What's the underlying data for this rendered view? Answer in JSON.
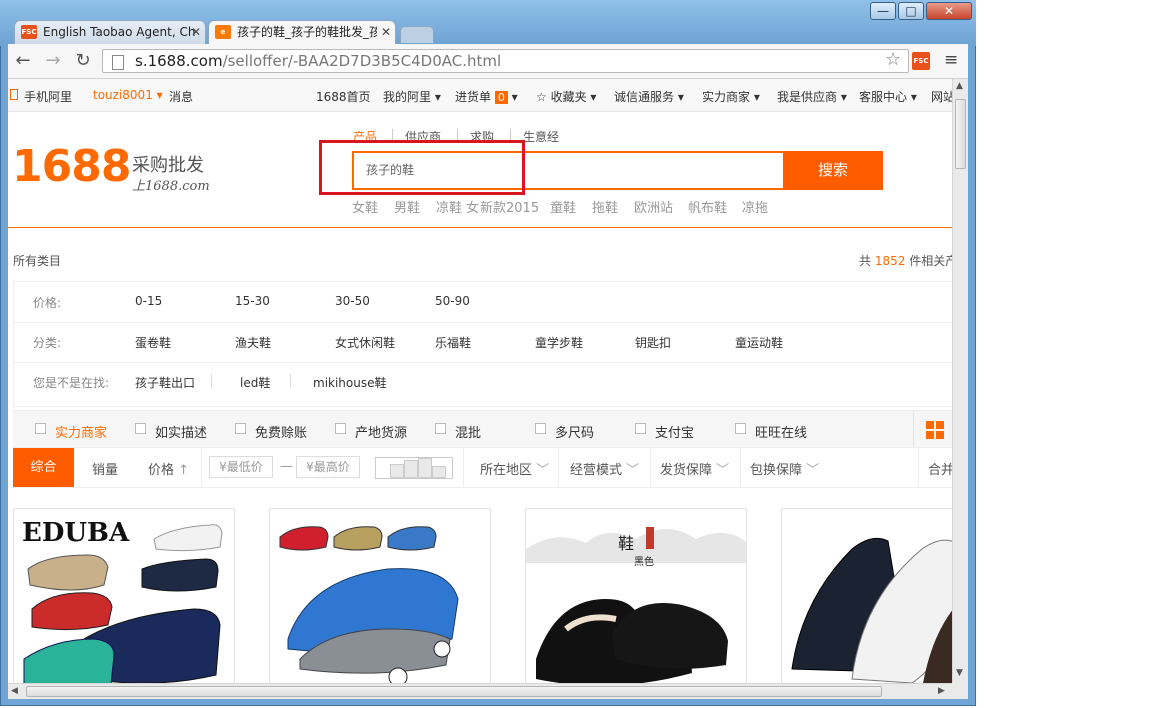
{
  "browser": {
    "tabs": [
      {
        "label": "English Taobao Agent, Ch",
        "icon": "FSC"
      },
      {
        "label": "孩子的鞋_孩子的鞋批发_孩",
        "icon": "1688"
      }
    ],
    "url_host": "s.1688.com",
    "url_path": "/selloffer/-BAA2D7D3B5C4D0AC.html",
    "ext_label": "FSC",
    "window_buttons": {
      "minimize": "—",
      "maximize": "□",
      "close": "✕"
    }
  },
  "site_nav": {
    "mobile": "手机阿里",
    "user": "touzi8001",
    "messages": "消息",
    "links": [
      "1688首页",
      "我的阿里",
      "进货单",
      "收藏夹",
      "诚信通服务",
      "实力商家",
      "我是供应商",
      "客服中心",
      "网站"
    ],
    "cart_count": "0"
  },
  "header": {
    "logo": "1688",
    "logo_line1": "采购批发",
    "logo_line2": "上1688.com",
    "search_tabs": [
      "产品",
      "供应商",
      "求购",
      "生意经"
    ],
    "search_value": "孩子的鞋",
    "search_button": "搜索",
    "hot_words": [
      "女鞋",
      "男鞋",
      "凉鞋 女",
      "新款2015",
      "童鞋",
      "拖鞋",
      "欧洲站",
      "帆布鞋",
      "凉拖"
    ]
  },
  "filters": {
    "all_categories": "所有类目",
    "count_prefix": "共",
    "count_value": "1852",
    "count_suffix": "件相关产",
    "price_label": "价格:",
    "price_options": [
      "0-15",
      "15-30",
      "30-50",
      "50-90"
    ],
    "category_label": "分类:",
    "category_options": [
      "蛋卷鞋",
      "渔夫鞋",
      "女式休闲鞋",
      "乐福鞋",
      "童学步鞋",
      "钥匙扣",
      "童运动鞋"
    ],
    "suggest_label": "您是不是在找:",
    "suggest_options": [
      "孩子鞋出口",
      "led鞋",
      "mikihouse鞋"
    ]
  },
  "checkbox_bar": {
    "items": [
      "实力商家",
      "如实描述",
      "免费赊账",
      "产地货源",
      "混批",
      "多尺码",
      "支付宝",
      "旺旺在线"
    ]
  },
  "sort_bar": {
    "active": "综合",
    "sales": "销量",
    "price": "价格",
    "min_price_placeholder": "¥最低价",
    "max_price_placeholder": "¥最高价",
    "dash": "—",
    "dropdowns": [
      "所在地区",
      "经营模式",
      "发货保障",
      "包换保障"
    ],
    "merge": "合并"
  },
  "products": [
    {
      "brand_text": "EDUBA"
    },
    {
      "brand_text": ""
    },
    {
      "brand_text": "鞋",
      "sub_text": "黑色"
    },
    {
      "brand_text": ""
    }
  ],
  "colors": {
    "accent": "#ff6a00",
    "highlight": "#d9161f"
  }
}
